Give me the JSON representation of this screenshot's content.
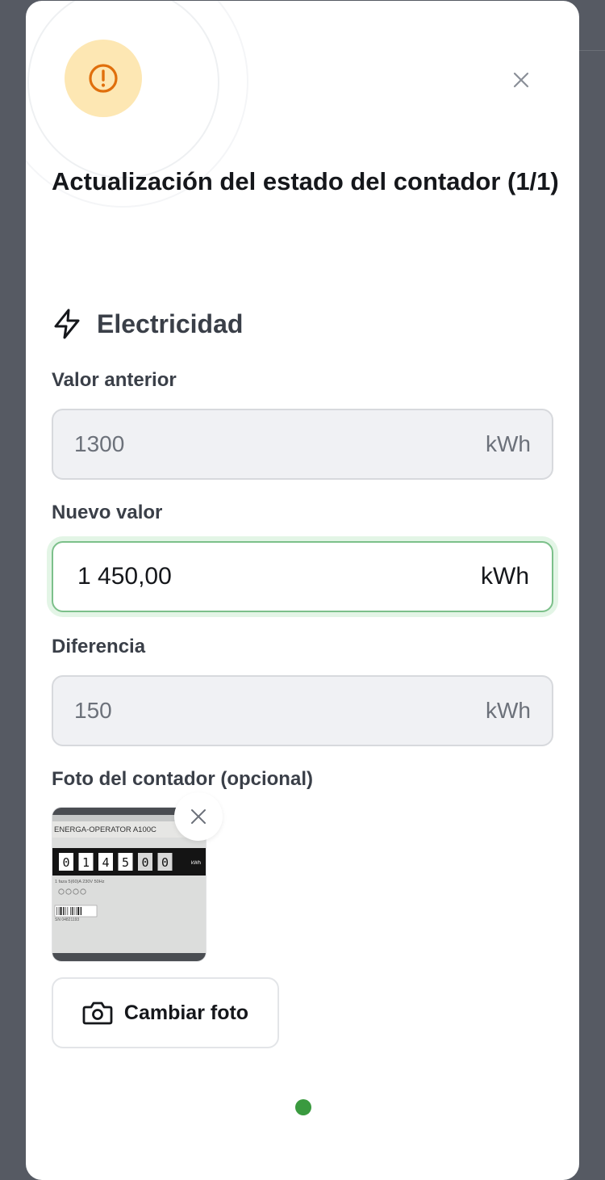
{
  "dialog": {
    "title": "Actualización del estado del contador (1/1)",
    "icon": "warning-icon",
    "close_icon": "close-icon"
  },
  "section": {
    "icon": "lightning-icon",
    "label": "Electricidad"
  },
  "fields": {
    "previous": {
      "label": "Valor anterior",
      "value": "1300",
      "unit": "kWh"
    },
    "new": {
      "label": "Nuevo valor",
      "value": "1 450,00",
      "unit": "kWh"
    },
    "difference": {
      "label": "Diferencia",
      "value": "150",
      "unit": "kWh"
    }
  },
  "photo": {
    "label": "Foto del contador (opcional)",
    "meter_brand": "ENERGA-OPERATOR  A100C",
    "digits": [
      "0",
      "1",
      "4",
      "5",
      "0",
      "0"
    ],
    "digit_unit": "kWh",
    "specs": "1 faza    5(60)A    230V    50Hz",
    "serial": "SN 04821193",
    "remove_icon": "close-icon",
    "change_button": "Cambiar foto",
    "change_icon": "camera-icon"
  },
  "colors": {
    "accent_green": "#3a9a3f",
    "warning_bg": "#fde7b3",
    "warning_fg": "#e06f0c"
  }
}
